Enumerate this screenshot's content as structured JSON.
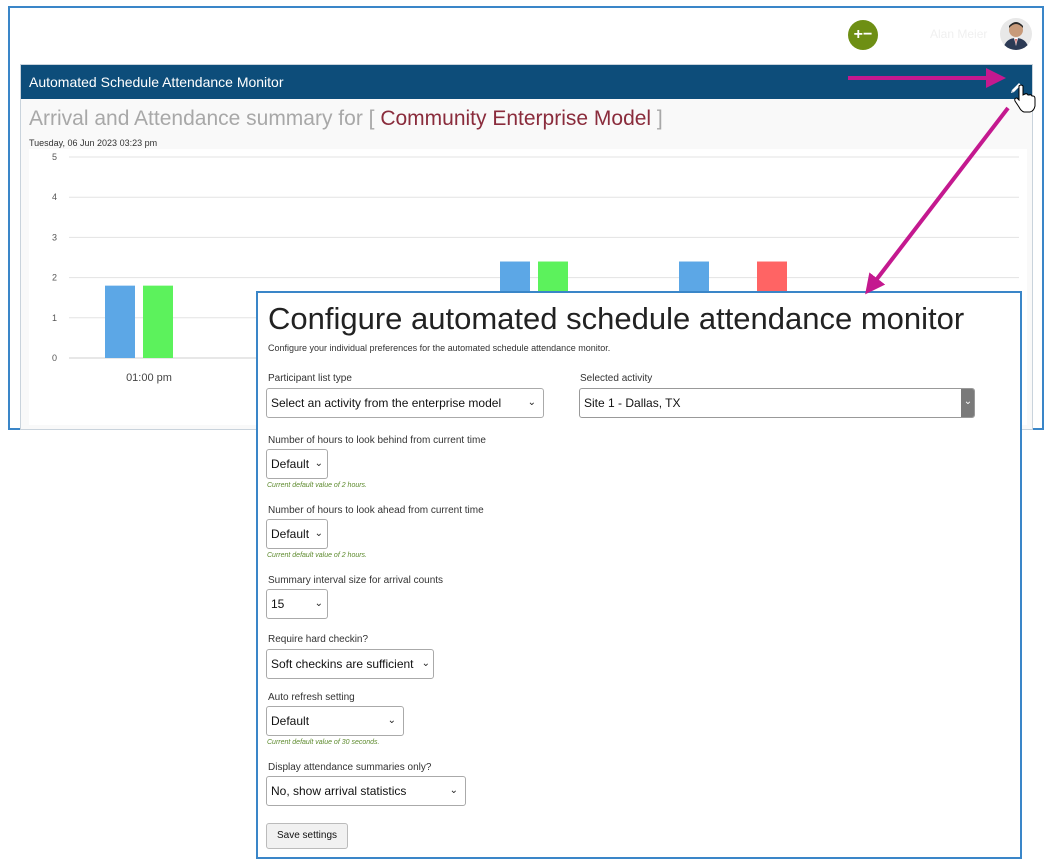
{
  "topbar": {
    "user_name": "Alan Meier"
  },
  "panel": {
    "title": "Automated Schedule Attendance Monitor",
    "summary_prefix": "Arrival and Attendance summary for [ ",
    "model_name": "Community Enterprise Model",
    "summary_suffix": " ]",
    "date": "Tuesday, 06 Jun 2023 03:23 pm"
  },
  "chart_data": {
    "type": "bar",
    "categories": [
      "01:00 pm",
      "",
      ""
    ],
    "ylim": [
      0,
      5
    ],
    "yticks": [
      "0",
      "1",
      "2",
      "3",
      "4",
      "5"
    ],
    "series": [
      {
        "color": "#5ca7e6",
        "values": [
          1.8,
          2.4,
          2.4
        ]
      },
      {
        "color": "#5cf25c",
        "values": [
          1.8,
          2.4,
          null
        ]
      },
      {
        "color": "#ff6464",
        "values": [
          null,
          null,
          2.4
        ]
      }
    ]
  },
  "config": {
    "title": "Configure automated schedule attendance monitor",
    "description": "Configure your individual preferences for the automated schedule attendance monitor.",
    "participant_list_label": "Participant list type",
    "participant_list_value": "Select an activity from the enterprise model",
    "selected_activity_label": "Selected activity",
    "selected_activity_value": "Site 1 - Dallas, TX",
    "hours_behind_label": "Number of hours to look behind from current time",
    "hours_behind_value": "Default",
    "hours_behind_hint": "Current default value of 2 hours.",
    "hours_ahead_label": "Number of hours to look ahead from current time",
    "hours_ahead_value": "Default",
    "hours_ahead_hint": "Current default value of 2 hours.",
    "interval_label": "Summary interval size for arrival counts",
    "interval_value": "15",
    "hard_checkin_label": "Require hard checkin?",
    "hard_checkin_value": "Soft checkins are sufficient",
    "auto_refresh_label": "Auto refresh setting",
    "auto_refresh_value": "Default",
    "auto_refresh_hint": "Current default value of 30 seconds.",
    "display_summaries_label": "Display attendance summaries only?",
    "display_summaries_value": "No, show arrival statistics",
    "save_label": "Save settings"
  },
  "colors": {
    "header_bg": "#0d4d7a",
    "frame_border": "#3a86c8",
    "arrow": "#c4198f",
    "plus_button": "#6e8f14",
    "model_text": "#8a2c3c",
    "hint_text": "#5d8a2d"
  },
  "icons": {
    "add_remove": "plus-minus-icon",
    "edit": "pencil-icon",
    "cursor": "hand-pointer-icon",
    "dropdown": "chevron-down-icon"
  }
}
